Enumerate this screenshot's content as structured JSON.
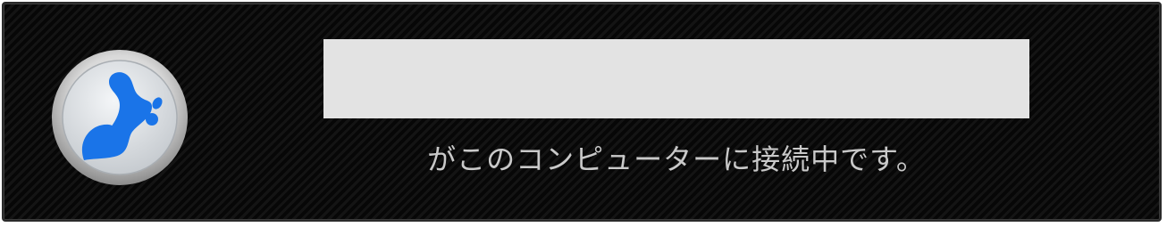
{
  "notification": {
    "logo_icon": "splashtop-logo-icon",
    "device_name": "",
    "message": "がこのコンピューターに接続中です。",
    "colors": {
      "background": "#0c0c0c",
      "text": "#c9c9c9",
      "redaction": "#e3e3e3",
      "logo_blue": "#1a74e8"
    }
  }
}
